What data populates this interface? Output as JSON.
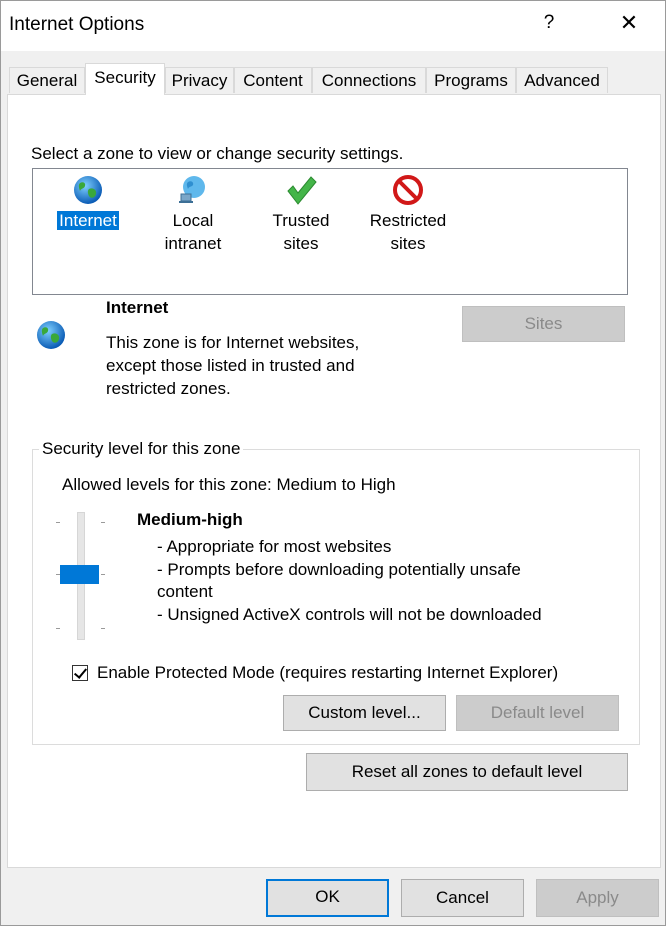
{
  "window": {
    "title": "Internet Options",
    "help_glyph": "?",
    "close_glyph": "✕"
  },
  "tabs": [
    {
      "label": "General"
    },
    {
      "label": "Security",
      "active": true
    },
    {
      "label": "Privacy"
    },
    {
      "label": "Content"
    },
    {
      "label": "Connections"
    },
    {
      "label": "Programs"
    },
    {
      "label": "Advanced"
    }
  ],
  "security": {
    "select_zone_text": "Select a zone to view or change security settings.",
    "zones": [
      {
        "label": "Internet",
        "icon": "globe-icon",
        "selected": true
      },
      {
        "label_line1": "Local",
        "label_line2": "intranet",
        "icon": "network-globe-icon"
      },
      {
        "label_line1": "Trusted",
        "label_line2": "sites",
        "icon": "green-check-icon"
      },
      {
        "label_line1": "Restricted",
        "label_line2": "sites",
        "icon": "red-prohibited-icon"
      }
    ],
    "zone_info": {
      "name": "Internet",
      "description": [
        "This zone is for Internet websites,",
        "except those listed in trusted and",
        "restricted zones."
      ],
      "icon": "globe-icon"
    },
    "sites_button": "Sites",
    "level_group": {
      "legend": "Security level for this zone",
      "allowed_levels": "Allowed levels for this zone: Medium to High",
      "level_name": "Medium-high",
      "bullets": [
        "- Appropriate for most websites",
        "- Prompts before downloading potentially unsafe",
        "content",
        "- Unsigned ActiveX controls will not be downloaded"
      ],
      "protected_mode_label": "Enable Protected Mode (requires restarting Internet Explorer)",
      "protected_mode_checked": true,
      "custom_level_button": "Custom level...",
      "default_level_button": "Default level"
    },
    "reset_button": "Reset all zones to default level"
  },
  "footer": {
    "ok": "OK",
    "cancel": "Cancel",
    "apply": "Apply"
  },
  "colors": {
    "accent": "#0078d7",
    "selection": "#0078d7",
    "disabled_text": "#8a8a8a"
  }
}
